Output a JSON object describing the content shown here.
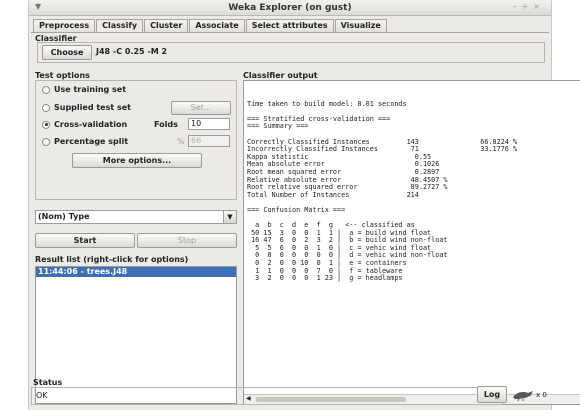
{
  "window": {
    "title": "Weka Explorer (on gust)"
  },
  "tabs": [
    "Preprocess",
    "Classify",
    "Cluster",
    "Associate",
    "Select attributes",
    "Visualize"
  ],
  "active_tab": "Classify",
  "classifier": {
    "section_label": "Classifier",
    "choose_label": "Choose",
    "spec": "J48 -C 0.25 -M 2"
  },
  "test_options": {
    "section_label": "Test options",
    "use_training_set": "Use training set",
    "supplied_test_set": "Supplied test set",
    "set_label": "Set...",
    "cross_validation": "Cross-validation",
    "folds_label": "Folds",
    "folds_value": "10",
    "percentage_split": "Percentage split",
    "percent_sign": "%",
    "percent_value": "66",
    "more_options": "More options...",
    "selected": "cross_validation"
  },
  "class_attribute": "(Nom) Type",
  "actions": {
    "start": "Start",
    "stop": "Stop"
  },
  "result_list": {
    "section_label": "Result list (right-click for options)",
    "items": [
      "11:44:06 - trees.J48"
    ]
  },
  "output": {
    "section_label": "Classifier output",
    "lines": [
      "",
      "Time taken to build model: 0.01 seconds",
      "",
      "=== Stratified cross-validation ===",
      "=== Summary ===",
      "",
      "Correctly Classified Instances         143               66.8224 %",
      "Incorrectly Classified Instances        71               33.1776 %",
      "Kappa statistic                          0.55",
      "Mean absolute error                      0.1026",
      "Root mean squared error                  0.2897",
      "Relative absolute error                 48.4507 %",
      "Root relative squared error             89.2727 %",
      "Total Number of Instances              214",
      "",
      "=== Confusion Matrix ===",
      "",
      "  a  b  c  d  e  f  g   <-- classified as",
      " 50 15  3  0  0  1  1 |  a = build wind float",
      " 16 47  6  0  2  3  2 |  b = build wind non-float",
      "  5  5  6  0  0  1  0 |  c = vehic wind float",
      "  0  0  0  0  0  0  0 |  d = vehic wind non-float",
      "  0  2  0  0 10  0  1 |  e = containers",
      "  1  1  0  0  0  7  0 |  f = tableware",
      "  3  2  0  0  0  1 23 |  g = headlamps"
    ]
  },
  "status": {
    "section_label": "Status",
    "text": "OK",
    "log_label": "Log",
    "x_count": "x 0"
  }
}
